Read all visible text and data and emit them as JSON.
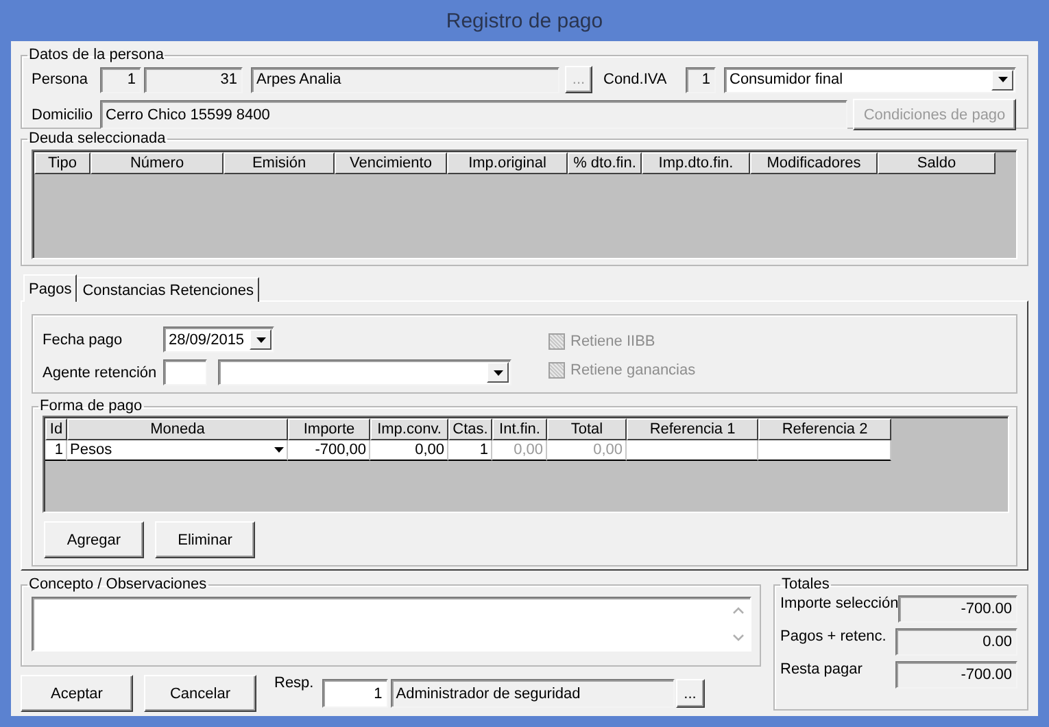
{
  "window": {
    "title": "Registro de pago"
  },
  "persona": {
    "legend": "Datos de la persona",
    "label": "Persona",
    "code1": "1",
    "code2": "31",
    "name": "Arpes Analia",
    "lookup_button": "...",
    "cond_iva_label": "Cond.IVA",
    "cond_iva_code": "1",
    "cond_iva_value": "Consumidor final",
    "domicilio_label": "Domicilio",
    "domicilio": "Cerro Chico 15599  8400",
    "conditions_button": {
      "label": "Condiciones de pago",
      "disabled": true
    }
  },
  "deuda": {
    "legend": "Deuda seleccionada",
    "columns": [
      "Tipo",
      "Número",
      "Emisión",
      "Vencimiento",
      "Imp.original",
      "% dto.fin.",
      "Imp.dto.fin.",
      "Modificadores",
      "Saldo"
    ]
  },
  "tabs": [
    {
      "label": "Pagos",
      "selected": true
    },
    {
      "label": "Constancias Retenciones",
      "selected": false
    }
  ],
  "pagos": {
    "fecha_label": "Fecha pago",
    "fecha": "28/09/2015",
    "agente_label": "Agente retención",
    "checkboxes": [
      {
        "label": "Retiene IIBB",
        "checked": false,
        "disabled": true
      },
      {
        "label": "Retiene ganancias",
        "checked": false,
        "disabled": true
      }
    ]
  },
  "forma_pago": {
    "legend": "Forma de pago",
    "columns": [
      {
        "label": "Id"
      },
      {
        "label": "Moneda"
      },
      {
        "label": "Importe"
      },
      {
        "label": "Imp.conv."
      },
      {
        "label": "Ctas."
      },
      {
        "label": "Int.fin."
      },
      {
        "label": "Total"
      },
      {
        "label": "Referencia 1"
      },
      {
        "label": "Referencia 2"
      }
    ],
    "rows": [
      {
        "cells": [
          {
            "text": "1",
            "disabled": false
          },
          {
            "text": "Pesos",
            "disabled": false
          },
          {
            "text": "-700,00",
            "disabled": false
          },
          {
            "text": "0,00",
            "disabled": false
          },
          {
            "text": "1",
            "disabled": false
          },
          {
            "text": "0,00",
            "disabled": true
          },
          {
            "text": "0,00",
            "disabled": true
          }
        ]
      }
    ],
    "buttons": [
      "Agregar",
      "Eliminar"
    ]
  },
  "concepto": {
    "legend": "Concepto / Observaciones"
  },
  "totales": {
    "legend": "Totales",
    "rows": [
      {
        "label": "Importe selección",
        "value": "-700.00"
      },
      {
        "label": "Pagos + retenc.",
        "value": "0.00"
      },
      {
        "label": "Resta pagar",
        "value": "-700.00"
      }
    ]
  },
  "footer": {
    "buttons": [
      "Aceptar",
      "Cancelar"
    ],
    "resp_label": "Resp.",
    "resp_code": "1",
    "resp_name": "Administrador de seguridad",
    "lookup_button": "..."
  }
}
